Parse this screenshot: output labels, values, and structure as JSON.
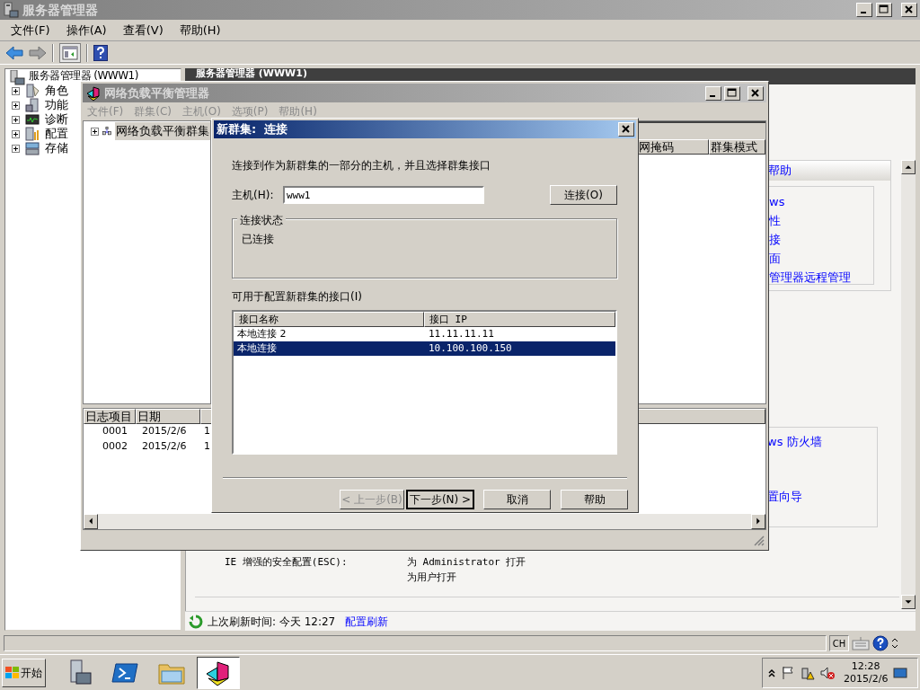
{
  "main_window": {
    "title": "服务器管理器",
    "menu": [
      "文件(F)",
      "操作(A)",
      "查看(V)",
      "帮助(H)"
    ],
    "tree": {
      "label": "服务器管理器 (WWW1)",
      "children": [
        {
          "label": "角色",
          "expanded": false
        },
        {
          "label": "功能",
          "expanded": false
        },
        {
          "label": "诊断",
          "expanded": false
        },
        {
          "label": "配置",
          "expanded": false
        },
        {
          "label": "存储",
          "expanded": false
        }
      ]
    },
    "content_title": "服务器管理器 (WWW1)",
    "help_section": {
      "title": "帮助",
      "links": [
        "ws",
        "性",
        "接",
        "面",
        "管理器远程管理"
      ]
    },
    "security_section": {
      "links": [
        "ws 防火墙",
        "置向导"
      ]
    },
    "ie_esc": {
      "label": "IE 增强的安全配置(ESC):",
      "values": [
        "为 Administrator 打开",
        "为用户打开"
      ]
    },
    "refresh": {
      "text": "上次刷新时间: 今天 12:27",
      "link": "配置刷新"
    },
    "status_bar": {
      "language": "CH"
    }
  },
  "nlb_window": {
    "title": "网络负载平衡管理器",
    "menu": [
      {
        "label": "文件(F)",
        "disabled": true
      },
      {
        "label": "群集(C)",
        "disabled": true
      },
      {
        "label": "主机(O)",
        "disabled": true
      },
      {
        "label": "选项(P)",
        "disabled": true
      },
      {
        "label": "帮助(H)",
        "disabled": true
      }
    ],
    "tree": [
      {
        "label": "网络负载平衡群集",
        "selected": true,
        "expanded": false
      }
    ],
    "cluster_columns": [
      "网掩码",
      "群集模式"
    ],
    "log": {
      "columns": [
        "日志项目",
        "日期"
      ],
      "rows": [
        [
          "0001",
          "2015/2/6",
          "1"
        ],
        [
          "0002",
          "2015/2/6",
          "1"
        ]
      ]
    }
  },
  "dialog": {
    "title": "新群集:  连接",
    "intro": "连接到作为新群集的一部分的主机，并且选择群集接口",
    "host": {
      "label": "主机(H):",
      "value": "www1"
    },
    "connect_button": "连接(O)",
    "status_group": {
      "title": "连接状态",
      "text": "已连接"
    },
    "interfaces_label": "可用于配置新群集的接口(I)",
    "interfaces": {
      "columns": [
        "接口名称",
        "接口 IP"
      ],
      "rows": [
        {
          "name": "本地连接 2",
          "ip": "11.11.11.11",
          "selected": false
        },
        {
          "name": "本地连接",
          "ip": "10.100.100.150",
          "selected": true
        }
      ]
    },
    "buttons": [
      {
        "label": "< 上一步(B)",
        "disabled": true,
        "default": false
      },
      {
        "label": "下一步(N) >",
        "disabled": false,
        "default": true
      },
      {
        "label": "取消",
        "disabled": false,
        "default": false
      },
      {
        "label": "帮助",
        "disabled": false,
        "default": false
      }
    ]
  },
  "taskbar": {
    "start": "开始",
    "apps": [
      {
        "kind": "server-manager",
        "selected": false
      },
      {
        "kind": "powershell",
        "selected": false
      },
      {
        "kind": "explorer",
        "selected": false
      },
      {
        "kind": "nlb",
        "selected": true
      }
    ],
    "clock": {
      "time": "12:28",
      "date": "2015/2/6"
    }
  }
}
